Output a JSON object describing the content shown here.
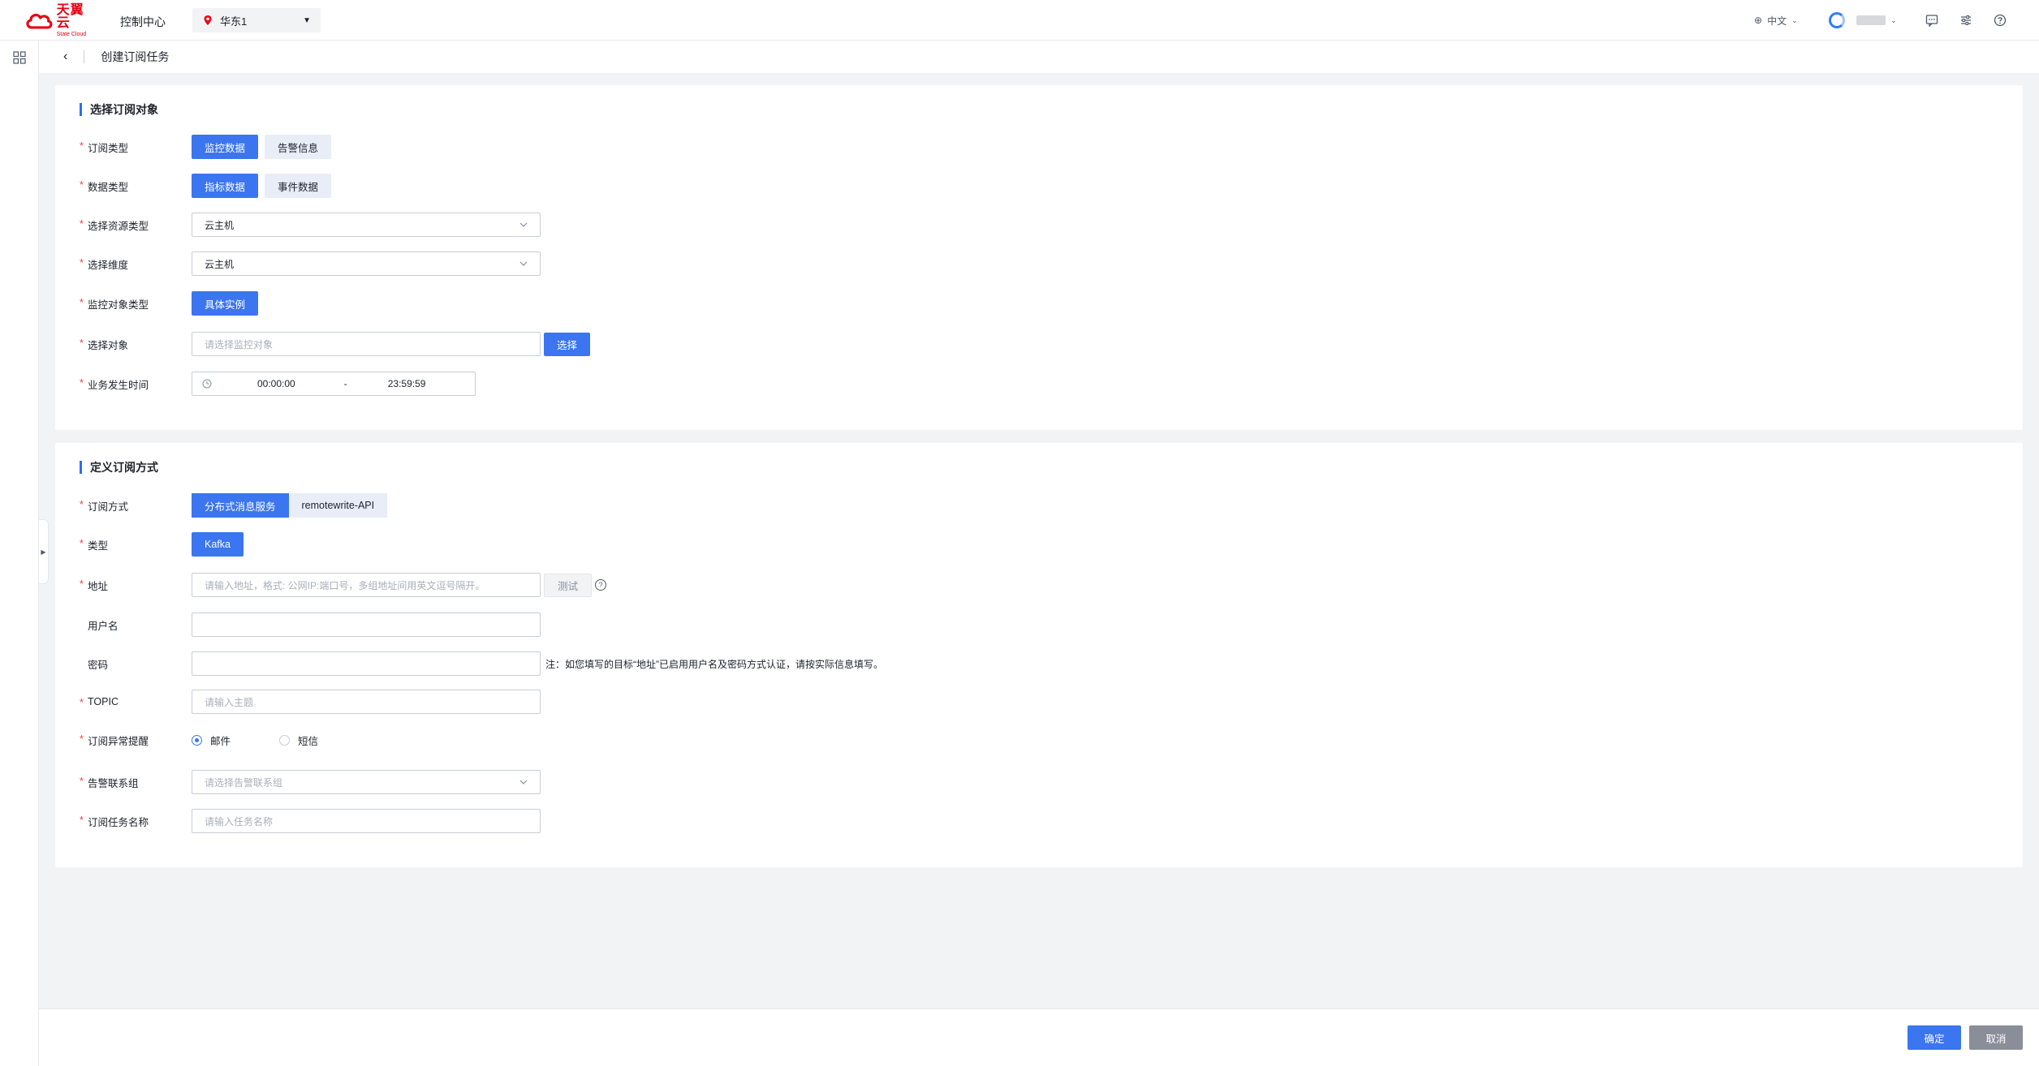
{
  "header": {
    "logo_cn": "天翼云",
    "logo_en": "State Cloud",
    "console": "控制中心",
    "region": "华东1",
    "language": "中文",
    "colors": {
      "brand": "#e60012",
      "accent": "#3b75ef"
    }
  },
  "breadcrumb": {
    "title": "创建订阅任务"
  },
  "section1": {
    "title": "选择订阅对象",
    "sub_type": {
      "label": "订阅类型",
      "options": [
        "监控数据",
        "告警信息"
      ],
      "selected": "监控数据"
    },
    "data_type": {
      "label": "数据类型",
      "options": [
        "指标数据",
        "事件数据"
      ],
      "selected": "指标数据"
    },
    "resource_type": {
      "label": "选择资源类型",
      "value": "云主机"
    },
    "dimension": {
      "label": "选择维度",
      "value": "云主机"
    },
    "object_type": {
      "label": "监控对象类型",
      "options": [
        "具体实例"
      ],
      "selected": "具体实例"
    },
    "object": {
      "label": "选择对象",
      "placeholder": "请选择监控对象",
      "button": "选择"
    },
    "biz_time": {
      "label": "业务发生时间",
      "start": "00:00:00",
      "sep": "-",
      "end": "23:59:59"
    }
  },
  "section2": {
    "title": "定义订阅方式",
    "method": {
      "label": "订阅方式",
      "options": [
        "分布式消息服务",
        "remotewrite-API"
      ],
      "selected": "分布式消息服务"
    },
    "type": {
      "label": "类型",
      "options": [
        "Kafka"
      ],
      "selected": "Kafka"
    },
    "address": {
      "label": "地址",
      "placeholder": "请输入地址，格式: 公网IP:端口号，多组地址间用英文逗号隔开。",
      "button": "测试"
    },
    "username": {
      "label": "用户名",
      "value": ""
    },
    "password": {
      "label": "密码",
      "value": "",
      "note": "注：如您填写的目标“地址”已启用用户名及密码方式认证，请按实际信息填写。"
    },
    "topic": {
      "label": "TOPIC",
      "placeholder": "请输入主题"
    },
    "alert": {
      "label": "订阅异常提醒",
      "options": [
        "邮件",
        "短信"
      ],
      "selected": "邮件"
    },
    "contact_group": {
      "label": "告警联系组",
      "placeholder": "请选择告警联系组"
    },
    "task_name": {
      "label": "订阅任务名称",
      "placeholder": "请输入任务名称"
    }
  },
  "footer": {
    "ok": "确定",
    "cancel": "取消"
  }
}
